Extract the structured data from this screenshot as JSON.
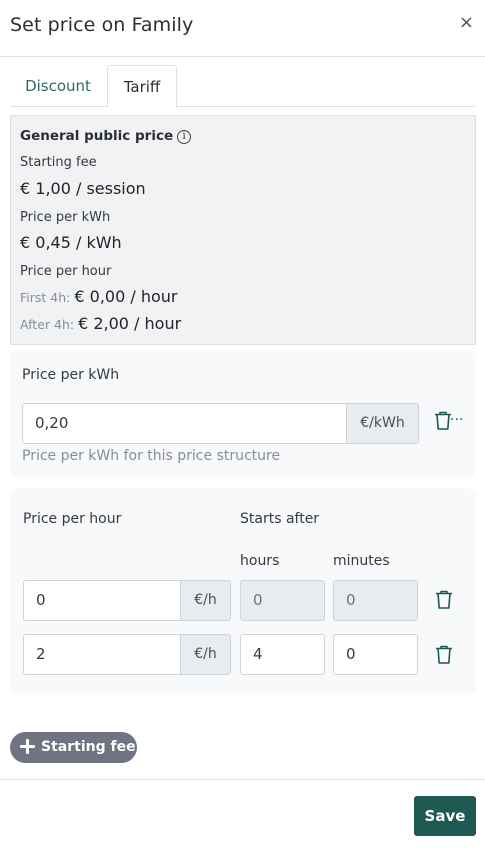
{
  "dialog": {
    "title": "Set price on Family",
    "close_glyph": "×"
  },
  "tabs": [
    {
      "label": "Discount",
      "active": false
    },
    {
      "label": "Tariff",
      "active": true
    }
  ],
  "public_price": {
    "title": "General public price",
    "info_glyph": "i",
    "starting_fee_label": "Starting fee",
    "starting_fee_value": "€ 1,00 / session",
    "kwh_label": "Price per kWh",
    "kwh_value": "€ 0,45 / kWh",
    "hour_label": "Price per hour",
    "first_prefix": "First 4h:",
    "first_value": "€ 0,00 / hour",
    "after_prefix": "After 4h:",
    "after_value": "€ 2,00 / hour"
  },
  "kwh_section": {
    "label": "Price per kWh",
    "value": "0,20",
    "unit": "€/kWh",
    "help": "Price per kWh for this price structure",
    "delete_suffix": "..."
  },
  "hour_section": {
    "label": "Price per hour",
    "starts_after_label": "Starts after",
    "hours_label": "hours",
    "minutes_label": "minutes",
    "rows": [
      {
        "price": "0",
        "unit": "€/h",
        "hours": "0",
        "minutes": "0"
      },
      {
        "price": "2",
        "unit": "€/h",
        "hours": "4",
        "minutes": "0"
      }
    ]
  },
  "buttons": {
    "starting_fee": "Starting fee",
    "save": "Save"
  },
  "colors": {
    "accent": "#1f5a52",
    "tab_text": "#2e6b62",
    "pill": "#6e7481"
  },
  "icons": {
    "close": "close-icon",
    "info": "info-icon",
    "trash": "trash-icon",
    "plus": "plus-icon"
  }
}
